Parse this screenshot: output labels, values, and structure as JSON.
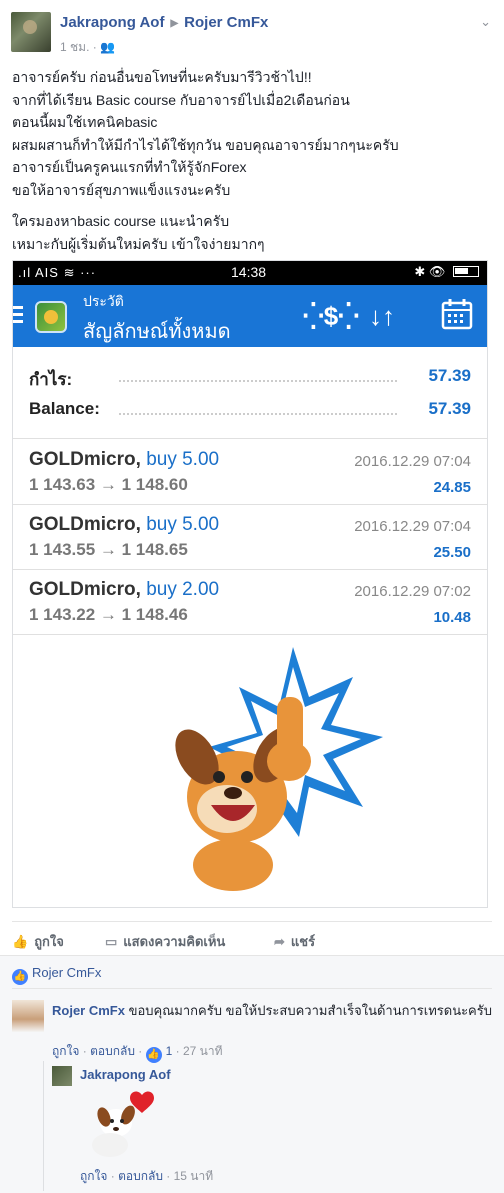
{
  "post": {
    "author": "Jakrapong Aof",
    "target": "Rojer CmFx",
    "time": "1 ชม.",
    "lines": [
      "อาจารย์ครับ ก่อนอื่นขอโทษที่นะครับมารีวิวช้าไป!!",
      "จากที่ได้เรียน Basic course กับอาจารย์ไปเมื่อ2เดือนก่อน",
      "ตอนนี้ผมใช้เทคนิคbasic",
      "ผสมผสานก็ทำให้มีกำไรได้ใช้ทุกวัน ขอบคุณอาจารย์มากๆนะครับ",
      "อาจารย์เป็นครูคนแรกที่ทำให้รู้จักForex",
      "ขอให้อาจารย์สุขภาพแข็งแรงนะครับ"
    ],
    "lines2": [
      "ใครมองหาbasic course แนะนำครับ",
      "เหมาะกับผู้เริ่มต้นใหม่ครับ เข้าใจง่ายมากๆ"
    ]
  },
  "screenshot": {
    "status": {
      "carrier": "AIS",
      "time": "14:38"
    },
    "app": {
      "subtitle": "ประวัติ",
      "title": "สัญลักษณ์ทั้งหมด"
    },
    "summary": [
      {
        "label": "กำไร:",
        "value": "57.39"
      },
      {
        "label": "Balance:",
        "value": "57.39"
      }
    ],
    "deals": [
      {
        "symbol": "GOLDmicro,",
        "op": "buy 5.00",
        "prices": "1 143.63 → 1 148.60",
        "date": "2016.12.29 07:04",
        "profit": "24.85"
      },
      {
        "symbol": "GOLDmicro,",
        "op": "buy 5.00",
        "prices": "1 143.55 → 1 148.65",
        "date": "2016.12.29 07:04",
        "profit": "25.50"
      },
      {
        "symbol": "GOLDmicro,",
        "op": "buy 2.00",
        "prices": "1 143.22 → 1 148.46",
        "date": "2016.12.29 07:02",
        "profit": "10.48"
      }
    ]
  },
  "actions": {
    "like": "ถูกใจ",
    "comment": "แสดงความคิดเห็น",
    "share": "แชร์"
  },
  "likes": {
    "name": "Rojer CmFx"
  },
  "comments": [
    {
      "author": "Rojer CmFx",
      "text": "ขอบคุณมากครับ ขอให้ประสบความสำเร็จในด้านการเทรดนะครับ",
      "like": "ถูกใจ",
      "reply": "ตอบกลับ",
      "likes_count": "1",
      "time": "27 นาที"
    },
    {
      "author": "Jakrapong Aof",
      "like": "ถูกใจ",
      "reply": "ตอบกลับ",
      "time": "15 นาที"
    }
  ],
  "colors": {
    "link": "#365899",
    "appbar": "#1975d6",
    "profit": "#1a6fc8"
  }
}
